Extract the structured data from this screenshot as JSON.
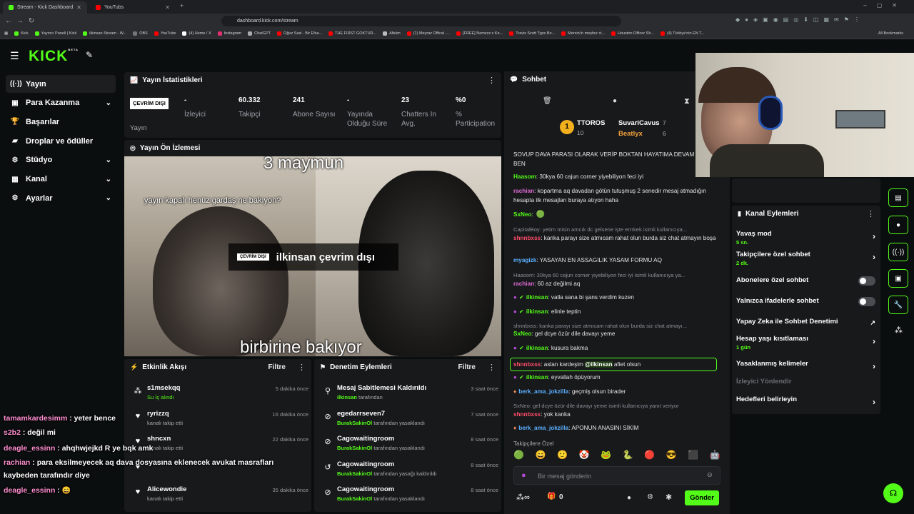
{
  "browser": {
    "tabs": [
      {
        "title": "Stream - Kick Dashboard"
      },
      {
        "title": "YouTubs"
      }
    ],
    "url": "dashboard.kick.com/stream",
    "bookmarks": [
      "Kick",
      "Yayıncı Paneli | Kick",
      "ilkinsan Stream - W...",
      "OBS",
      "YouTube",
      "(4) Home / X",
      "Instagram",
      "ChatGPT",
      "Oğuz Sasi - Bir Efsa...",
      "THE FIRST GOKTUR...",
      "Albüm",
      "(1) Meyraz Offical -...",
      "[FREE] Nemzzz x Ko...",
      "Travis Scott Type Be...",
      "Mersin'in meşhur ci...",
      "Houston Officer Sh...",
      "(4) Türkiye'nin EN T..."
    ],
    "all_bookmarks": "All Bookmarks"
  },
  "logo": "KICK",
  "logo_beta": "BETA",
  "sidebar": {
    "items": [
      {
        "label": "Yayın",
        "icon": "broadcast-icon"
      },
      {
        "label": "Para Kazanma",
        "icon": "dollar-icon"
      },
      {
        "label": "Başarılar",
        "icon": "trophy-icon"
      },
      {
        "label": "Droplar ve ödüller",
        "icon": "gift-icon"
      },
      {
        "label": "Stüdyo",
        "icon": "studio-icon"
      },
      {
        "label": "Kanal",
        "icon": "channel-icon"
      },
      {
        "label": "Ayarlar",
        "icon": "gear-icon"
      }
    ]
  },
  "stats": {
    "title": "Yayın İstatistikleri",
    "status_badge": "ÇEVRİM DIŞI",
    "status_label": "Yayın",
    "items": [
      {
        "value": "-",
        "label": "İzleyici"
      },
      {
        "value": "60.332",
        "label": "Takipçi"
      },
      {
        "value": "241",
        "label": "Abone Sayısı"
      },
      {
        "value": "-",
        "label": "Yayında Olduğu Süre"
      },
      {
        "value": "23",
        "label": "Chatters In Avg."
      },
      {
        "value": "%0",
        "label": "% Participation"
      }
    ]
  },
  "preview": {
    "title": "Yayın Ön İzlemesi",
    "top_caption": "3 maymun",
    "mid_caption": "yayın kapalı henüz gardaş ne bakıyon?",
    "bottom_caption": "birbirine bakıyor",
    "offline_badge": "ÇEVRİM DIŞI",
    "offline_text": "ilkinsan çevrim dışı"
  },
  "activity": {
    "title": "Etkinlik Akışı",
    "filter": "Filtre",
    "rows": [
      {
        "name": "s1msekqq",
        "sub": "Su İç alındı",
        "time": "5 dakika önce",
        "icon": "reward-icon"
      },
      {
        "name": "ryrizzq",
        "sub": "kanalı takip etti",
        "time": "16 dakika önce",
        "icon": "heart-icon"
      },
      {
        "name": "shncxn",
        "sub": "kanalı takip etti",
        "time": "22 dakika önce",
        "icon": "heart-icon"
      },
      {
        "name": "",
        "sub": "",
        "time": "",
        "icon": "heart-icon"
      },
      {
        "name": "Alicewondie",
        "sub": "kanalı takip etti",
        "time": "35 dakika önce",
        "icon": "heart-icon"
      }
    ]
  },
  "moderation": {
    "title": "Denetim Eylemleri",
    "filter": "Filtre",
    "rows": [
      {
        "title": "Mesaj Sabitlemesi Kaldırıldı",
        "actor": "ilkinsan",
        "rest": " tarafından",
        "time": "3 saat önce",
        "icon": "unpin-icon"
      },
      {
        "title": "egedarrseven7",
        "actor": "BurakSakinOl",
        "rest": " tarafından yasaklandı",
        "time": "7 saat önce",
        "icon": "ban-icon"
      },
      {
        "title": "Cagowaitingroom",
        "actor": "BurakSakinOl",
        "rest": " tarafından yasaklandı",
        "time": "8 saat önce",
        "icon": "ban-icon"
      },
      {
        "title": "Cagowaitingroom",
        "actor": "BurakSakinOl",
        "rest": " tarafından yasağı kaldırıldı",
        "time": "8 saat önce",
        "icon": "unban-icon"
      },
      {
        "title": "Cagowaitingroom",
        "actor": "BurakSakinOl",
        "rest": " tarafından yasaklandı",
        "time": "8 saat önce",
        "icon": "ban-icon"
      }
    ]
  },
  "chat": {
    "title": "Sohbet",
    "leaders": [
      {
        "name": "TTOROS",
        "count": "10"
      },
      {
        "name": "SuvariCavus",
        "count": "7"
      },
      {
        "name": "Beatlyx",
        "count": "6"
      }
    ],
    "lines": [
      {
        "text": "SOVUP DAVA PARASI OLARAK VERİP BOKTAN HAYATIMA DEVAM EDERİM BEN",
        "user": "",
        "color": ""
      },
      {
        "user": "Haasom",
        "color": "#53fc18",
        "text": ": 30kya 60 cajun corner yiyebiliyon feci iyi"
      },
      {
        "user": "rachian",
        "color": "#e06bd6",
        "text": ": kopartma aq davadan götün tutuşmuş 2 senedir mesaj atmadığın hesapta ilk mesajları buraya atıyon haha"
      },
      {
        "user": "SxNeo",
        "color": "#53fc18",
        "text": ":"
      },
      {
        "sys": "CapitalBoy: yetim misin amcık dc gelsene işte errrkek isimli kullanıcıya..."
      },
      {
        "user": "shnnbxss",
        "color": "#ff4d6a",
        "text": ": kanka parayı size atmıcam rahat olun burda siz chat atmayın boşa"
      },
      {
        "user": "myagizk",
        "color": "#5ab0ff",
        "text": ": YASAYAN EN ASSAGILIK YASAM FORMU AQ"
      },
      {
        "sys": "Haasom: 30kya 60 cajun corner yiyebiliyon feci iyi isimli kullanıcıya ya..."
      },
      {
        "user": "rachian",
        "color": "#e06bd6",
        "text": ": 60 az değilmi aq"
      },
      {
        "user": "ilkinsan",
        "color": "#53fc18",
        "text": ": valla sana bi şans verdim kuzen"
      },
      {
        "user": "ilkinsan",
        "color": "#53fc18",
        "text": ": elinle teptin"
      },
      {
        "sys": "shnnbxss: kanka parayı size atmıcam rahat olun burda siz chat atmayı..."
      },
      {
        "user": "SxNeo",
        "color": "#53fc18",
        "text": ": gel dcye özür dile davayı yeme"
      },
      {
        "user": "ilkinsan",
        "color": "#53fc18",
        "text": ": kusura bakma"
      },
      {
        "user": "shnnbxss",
        "color": "#ff4d6a",
        "text": ": aslan kardeşim ",
        "mention": "@ilkinsan",
        "text2": " afiet olsun"
      },
      {
        "user": "ilkinsan",
        "color": "#53fc18",
        "text": ": eyvallah öpüyorum"
      },
      {
        "user": "berk_ama_jokzilla",
        "color": "#5ab0ff",
        "text": ": geçmiş olsun birader"
      },
      {
        "sys": "SxNeo: gel dcye özür dile davayı yeme isimli kullanıcıya yanıt veriyor"
      },
      {
        "user": "shnnbxss",
        "color": "#ff4d6a",
        "text": ": yok kanka"
      },
      {
        "user": "berk_ama_jokzilla",
        "color": "#5ab0ff",
        "text": ": APONUN ANASINI SİKİM"
      }
    ],
    "emote_label": "Takipçilere Özel",
    "placeholder": "Bir mesaj gönderin",
    "points": "0",
    "send": "Gönder"
  },
  "channel_actions": {
    "title": "Kanal Eylemleri",
    "items": [
      {
        "label": "Yavaş mod",
        "sub": "5 sn.",
        "type": "arrow"
      },
      {
        "label": "Takipçilere özel sohbet",
        "sub": "2 dk.",
        "type": "arrow"
      },
      {
        "label": "Abonelere özel sohbet",
        "sub": "",
        "type": "toggle"
      },
      {
        "label": "Yalnızca ifadelerle sohbet",
        "sub": "",
        "type": "toggle"
      },
      {
        "label": "Yapay Zeka ile Sohbet Denetimi",
        "sub": "",
        "type": "external"
      },
      {
        "label": "Hesap yaşı kısıtlaması",
        "sub": "1 gün",
        "type": "arrow"
      },
      {
        "label": "Yasaklanmış kelimeler",
        "sub": "",
        "type": "arrow"
      },
      {
        "label": "İzleyici Yönlendir",
        "sub": "",
        "type": "disabled"
      },
      {
        "label": "Hedefleri belirleyin",
        "sub": "",
        "type": "arrow"
      }
    ]
  },
  "overlay_chat": [
    {
      "user": "tamamkardesimm",
      "color": "#ff8fd0",
      "text": " : yeter bence"
    },
    {
      "user": "s2b2",
      "color": "#ff8fd0",
      "text": " : değil mi"
    },
    {
      "user": "deagle_essinn",
      "color": "#ff8fd0",
      "text": " : ahqhwjejkd R ye bqk amk"
    },
    {
      "user": "rachian",
      "color": "#ff8fd0",
      "text": " : para eksilmeyecek aq dava dosyasına eklenecek avukat masrafları"
    },
    {
      "user": "",
      "color": "",
      "text": "kaybeden tarafındır diye"
    },
    {
      "user": "deagle_essinn",
      "color": "#ff8fd0",
      "text": " : "
    }
  ],
  "colors": {
    "accent": "#53fc18",
    "panel": "#18191b",
    "bg": "#0b0e0f"
  }
}
